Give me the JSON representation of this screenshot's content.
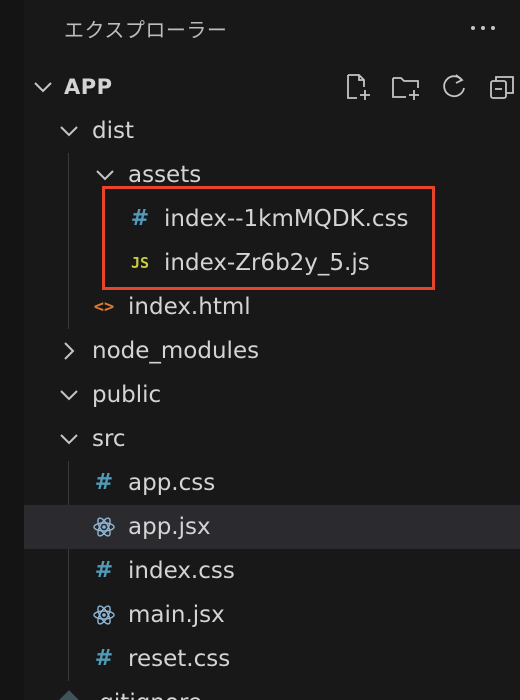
{
  "explorer": {
    "title": "エクスプローラー",
    "more_icon": "ellipsis-icon",
    "root_label": "APP",
    "toolbar": {
      "new_file_icon": "new-file-icon",
      "new_folder_icon": "new-folder-icon",
      "refresh_icon": "refresh-icon",
      "collapse_icon": "collapse-all-icon"
    },
    "tree": {
      "dist": "dist",
      "assets": "assets",
      "css_file": "index--1kmMQDK.css",
      "js_file": "index-Zr6b2y_5.js",
      "js_badge": "JS",
      "html_file": "index.html",
      "html_badge": "<>",
      "node_modules": "node_modules",
      "public": "public",
      "src": "src",
      "app_css": "app.css",
      "app_jsx": "app.jsx",
      "index_css": "index.css",
      "main_jsx": "main.jsx",
      "reset_css": "reset.css",
      "gitignore": ".gitignore",
      "hash_badge": "#"
    },
    "colors": {
      "css_icon": "#519aba",
      "js_icon": "#cbcb41",
      "html_icon": "#e37933",
      "react_icon": "#8fb7d6",
      "highlight": "#e8432b",
      "selected_row": "#2b2b2f"
    }
  }
}
